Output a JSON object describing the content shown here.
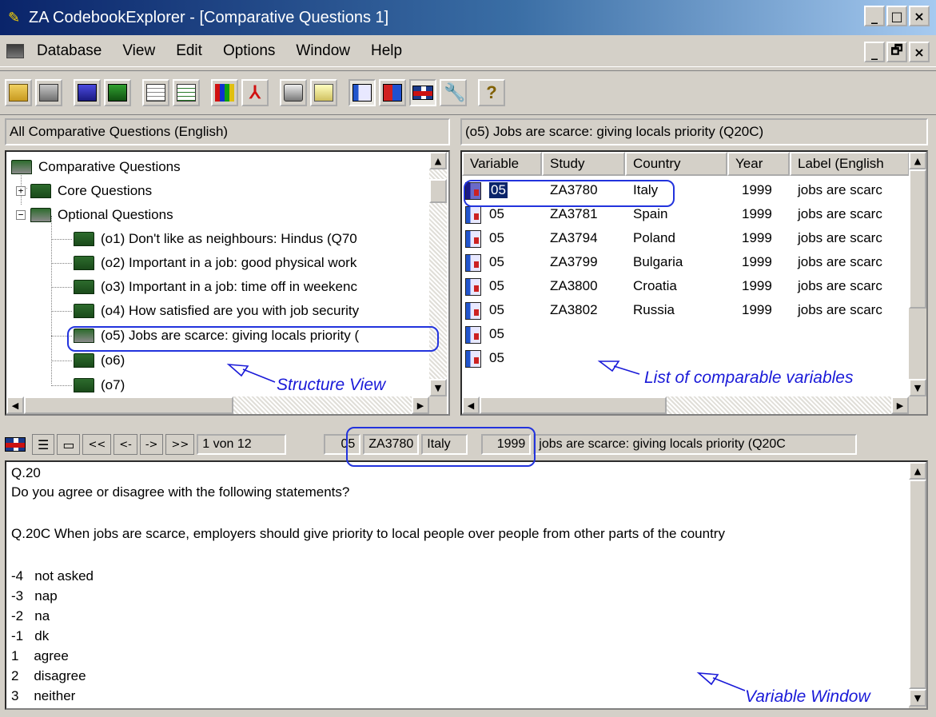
{
  "window": {
    "title": "ZA CodebookExplorer - [Comparative Questions 1]",
    "min_label": "_",
    "max_label": "□",
    "close_label": "×",
    "restore_label": "🗗"
  },
  "menu": [
    "Database",
    "View",
    "Edit",
    "Options",
    "Window",
    "Help"
  ],
  "toolbar": [
    "open-icon",
    "database-icon",
    "book-blue-icon",
    "book-green-icon",
    "table-icon",
    "table2-icon",
    "chart-icon",
    "pdf-icon",
    "printer-icon",
    "search-icon",
    "document-icon",
    "compare-icon",
    "flag-uk-icon",
    "tools-icon",
    "help-icon"
  ],
  "left_pane": {
    "header": "All Comparative Questions (English)",
    "tree": {
      "root": "Comparative Questions",
      "core": "Core Questions",
      "optional": "Optional Questions",
      "items": [
        "(o1)  Don't like as neighbours: Hindus (Q70",
        "(o2)  Important in a job: good physical work",
        "(o3)  Important in a job: time off in weekenc",
        "(o4)  How satisfied are you with job security",
        "(o5)  Jobs are scarce: giving locals priority (",
        "(o6)",
        "(o7)"
      ]
    },
    "annotation": "Structure View"
  },
  "right_pane": {
    "header": "(o5)  Jobs are scarce: giving locals priority (Q20C)",
    "columns": [
      "Variable",
      "Study",
      "Country",
      "Year",
      "Label (English"
    ],
    "rows": [
      {
        "variable": "05",
        "study": "ZA3780",
        "country": "Italy",
        "year": "1999",
        "label": "jobs are scarc"
      },
      {
        "variable": "05",
        "study": "ZA3781",
        "country": "Spain",
        "year": "1999",
        "label": "jobs are scarc"
      },
      {
        "variable": "05",
        "study": "ZA3794",
        "country": "Poland",
        "year": "1999",
        "label": "jobs are scarc"
      },
      {
        "variable": "05",
        "study": "ZA3799",
        "country": "Bulgaria",
        "year": "1999",
        "label": "jobs are scarc"
      },
      {
        "variable": "05",
        "study": "ZA3800",
        "country": "Croatia",
        "year": "1999",
        "label": "jobs are scarc"
      },
      {
        "variable": "05",
        "study": "ZA3802",
        "country": "Russia",
        "year": "1999",
        "label": "jobs are scarc"
      },
      {
        "variable": "05",
        "study": "",
        "country": "",
        "year": "",
        "label": ""
      },
      {
        "variable": "05",
        "study": "",
        "country": "",
        "year": "",
        "label": ""
      }
    ],
    "annotation": "List of comparable variables"
  },
  "navbar": {
    "first": "<<",
    "prev": "<-",
    "next": "->",
    "last": ">>",
    "position": "1 von 12",
    "variable": "05",
    "study": "ZA3780",
    "country": "Italy",
    "year": "1999",
    "label": "jobs are scarce: giving locals priority (Q20C"
  },
  "variable_window": {
    "lines": [
      "Q.20",
      "Do you agree or disagree with the following statements?",
      "",
      "Q.20C When jobs are scarce, employers should give priority to local people over people from other parts of the country",
      "",
      "-4   not asked",
      "-3   nap",
      "-2   na",
      "-1   dk",
      "1    agree",
      "2    disagree",
      "3    neither"
    ],
    "annotation": "Variable Window"
  },
  "colors": {
    "annotation": "#1a1ad8",
    "title_bar": "#0a246a"
  }
}
